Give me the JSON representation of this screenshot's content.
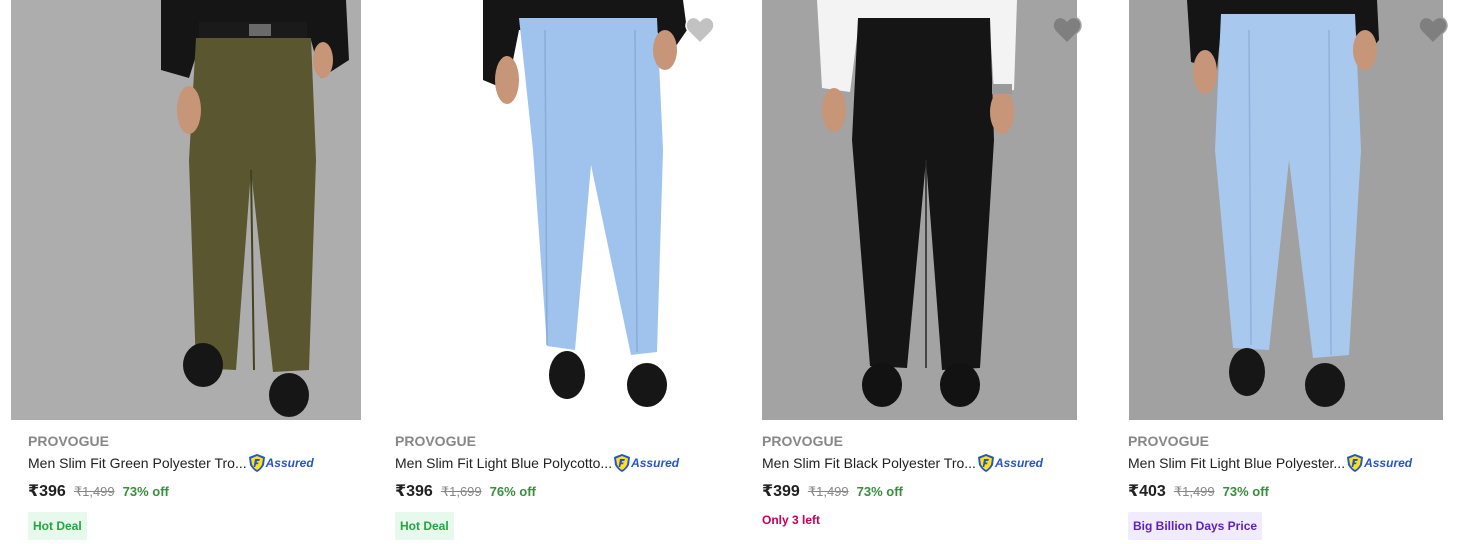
{
  "colors": {
    "brand_gray": "#878787",
    "discount_green": "#388e3c",
    "assured_blue": "#2455c7",
    "hot_deal_bg": "#e7f8ec",
    "hot_deal_text": "#26a541",
    "bbd_bg": "#f1ecfb",
    "bbd_text": "#5e22b9",
    "stock_pink": "#c70055"
  },
  "products": [
    {
      "brand": "PROVOGUE",
      "title": "Men Slim Fit Green Polyester Tro...",
      "assured_label": "Assured",
      "price": "₹396",
      "mrp": "₹1,499",
      "discount": "73% off",
      "tag": "Hot Deal",
      "icons": [
        "assured-shield-icon"
      ]
    },
    {
      "brand": "PROVOGUE",
      "title": "Men Slim Fit Light Blue Polycotto...",
      "assured_label": "Assured",
      "price": "₹396",
      "mrp": "₹1,699",
      "discount": "76% off",
      "tag": "Hot Deal",
      "icons": [
        "heart-icon",
        "assured-shield-icon"
      ]
    },
    {
      "brand": "PROVOGUE",
      "title": "Men Slim Fit Black Polyester Tro...",
      "assured_label": "Assured",
      "price": "₹399",
      "mrp": "₹1,499",
      "discount": "73% off",
      "stock_note": "Only 3 left",
      "icons": [
        "heart-icon",
        "assured-shield-icon"
      ]
    },
    {
      "brand": "PROVOGUE",
      "title": "Men Slim Fit Light Blue Polyester...",
      "assured_label": "Assured",
      "price": "₹403",
      "mrp": "₹1,499",
      "discount": "73% off",
      "tag": "Big Billion Days Price",
      "icons": [
        "heart-icon",
        "assured-shield-icon"
      ]
    }
  ]
}
